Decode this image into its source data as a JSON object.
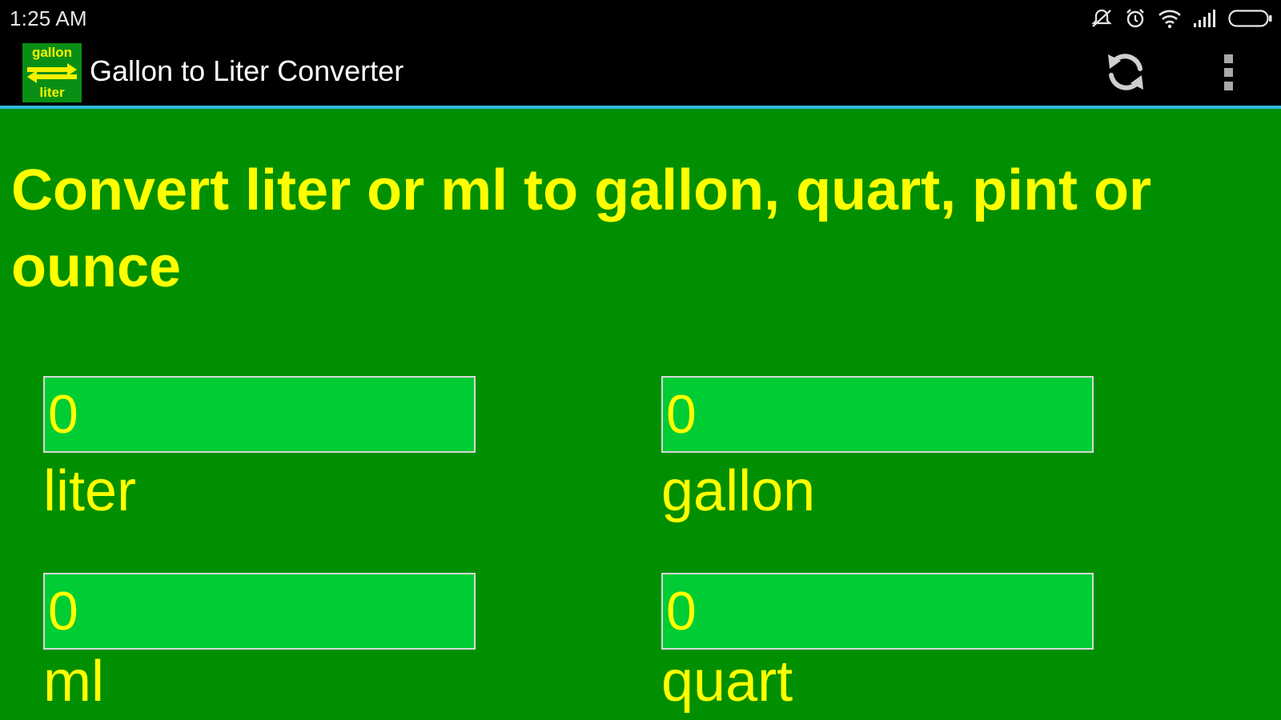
{
  "status_bar": {
    "time": "1:25 AM"
  },
  "app_bar": {
    "logo_top": "gallon",
    "logo_bottom": "liter",
    "title": "Gallon to Liter Converter"
  },
  "main": {
    "headline": "Convert liter or ml to gallon, quart, pint or ounce",
    "fields": [
      {
        "value": "0",
        "unit": "liter"
      },
      {
        "value": "0",
        "unit": "gallon"
      },
      {
        "value": "0",
        "unit": "ml"
      },
      {
        "value": "0",
        "unit": "quart"
      }
    ]
  },
  "colors": {
    "background": "#008f00",
    "field": "#00cc33",
    "text": "#ffff00",
    "appbar_divider": "#33b5e5"
  },
  "icons": [
    "mute-icon",
    "alarm-icon",
    "wifi-icon",
    "signal-icon",
    "battery-icon",
    "refresh-icon",
    "overflow-menu-icon"
  ]
}
